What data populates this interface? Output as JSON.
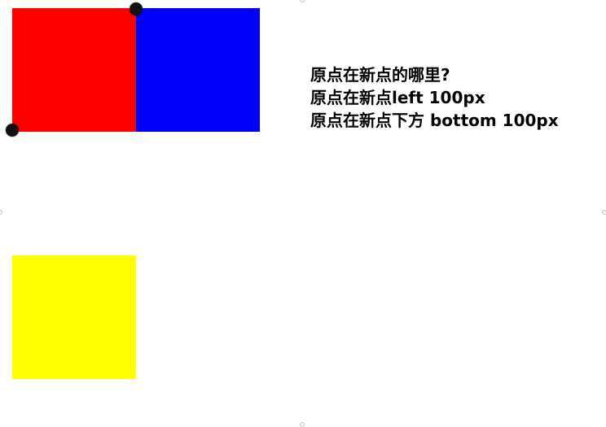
{
  "shapes": {
    "red": {
      "color": "#ff0000"
    },
    "blue": {
      "color": "#0000ff"
    },
    "yellow": {
      "color": "#ffff00"
    },
    "marker": {
      "color": "#111111"
    }
  },
  "notes": {
    "line1": "原点在新点的哪里?",
    "line2": "原点在新点left 100px",
    "line3": "原点在新点下方 bottom 100px"
  }
}
